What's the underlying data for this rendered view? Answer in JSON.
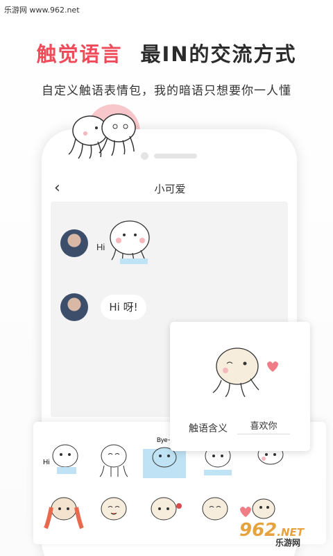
{
  "watermark": "乐游网 www.962.net",
  "hero": {
    "title_red": "触觉语言",
    "title_dark": "最IN的交流方式",
    "subtitle": "自定义触语表情包，我的暗语只想要你一人懂"
  },
  "chat": {
    "title": "小可爱",
    "back_icon": "chevron-left-icon",
    "sticker_text": "Hi",
    "message": "Hi 呀!"
  },
  "panel": {
    "label": "触语含义",
    "value": "喜欢你"
  },
  "tray": {
    "sticker_caption": "Bye~"
  },
  "brand": {
    "logo": "962",
    "domain": ".NET",
    "tagline": "乐游网"
  },
  "colors": {
    "accent": "#ef4b5a",
    "pink": "#f7c7cb",
    "heart": "#f07d86",
    "sticker_blue": "#bfe3f5"
  }
}
